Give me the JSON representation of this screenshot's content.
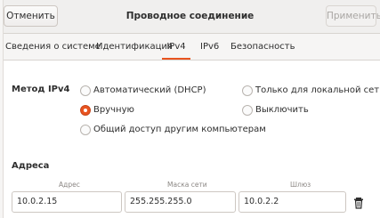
{
  "header": {
    "cancel_label": "Отменить",
    "title": "Проводное соединение",
    "apply_label": "Применить"
  },
  "tabs": [
    {
      "label": "Сведения о системе",
      "active": false
    },
    {
      "label": "Идентификация",
      "active": false
    },
    {
      "label": "IPv4",
      "active": true
    },
    {
      "label": "IPv6",
      "active": false
    },
    {
      "label": "Безопасность",
      "active": false
    }
  ],
  "ipv4": {
    "method_label": "Метод IPv4",
    "options": [
      {
        "label": "Автоматический (DHCP)",
        "checked": false
      },
      {
        "label": "Только для локальной сети",
        "checked": false
      },
      {
        "label": "Вручную",
        "checked": true
      },
      {
        "label": "Выключить",
        "checked": false
      },
      {
        "label": "Общий доступ другим компьютерам",
        "checked": false
      }
    ],
    "addresses_label": "Адреса",
    "columns": {
      "address": "Адрес",
      "netmask": "Маска сети",
      "gateway": "Шлюз"
    },
    "row": {
      "address": "10.0.2.15",
      "netmask": "255.255.255.0",
      "gateway": "10.0.2.2"
    }
  },
  "colors": {
    "accent": "#e95420",
    "header_bg": "#f0efee",
    "content_bg": "#ffffff"
  },
  "icons": {
    "delete": "trash-icon"
  }
}
